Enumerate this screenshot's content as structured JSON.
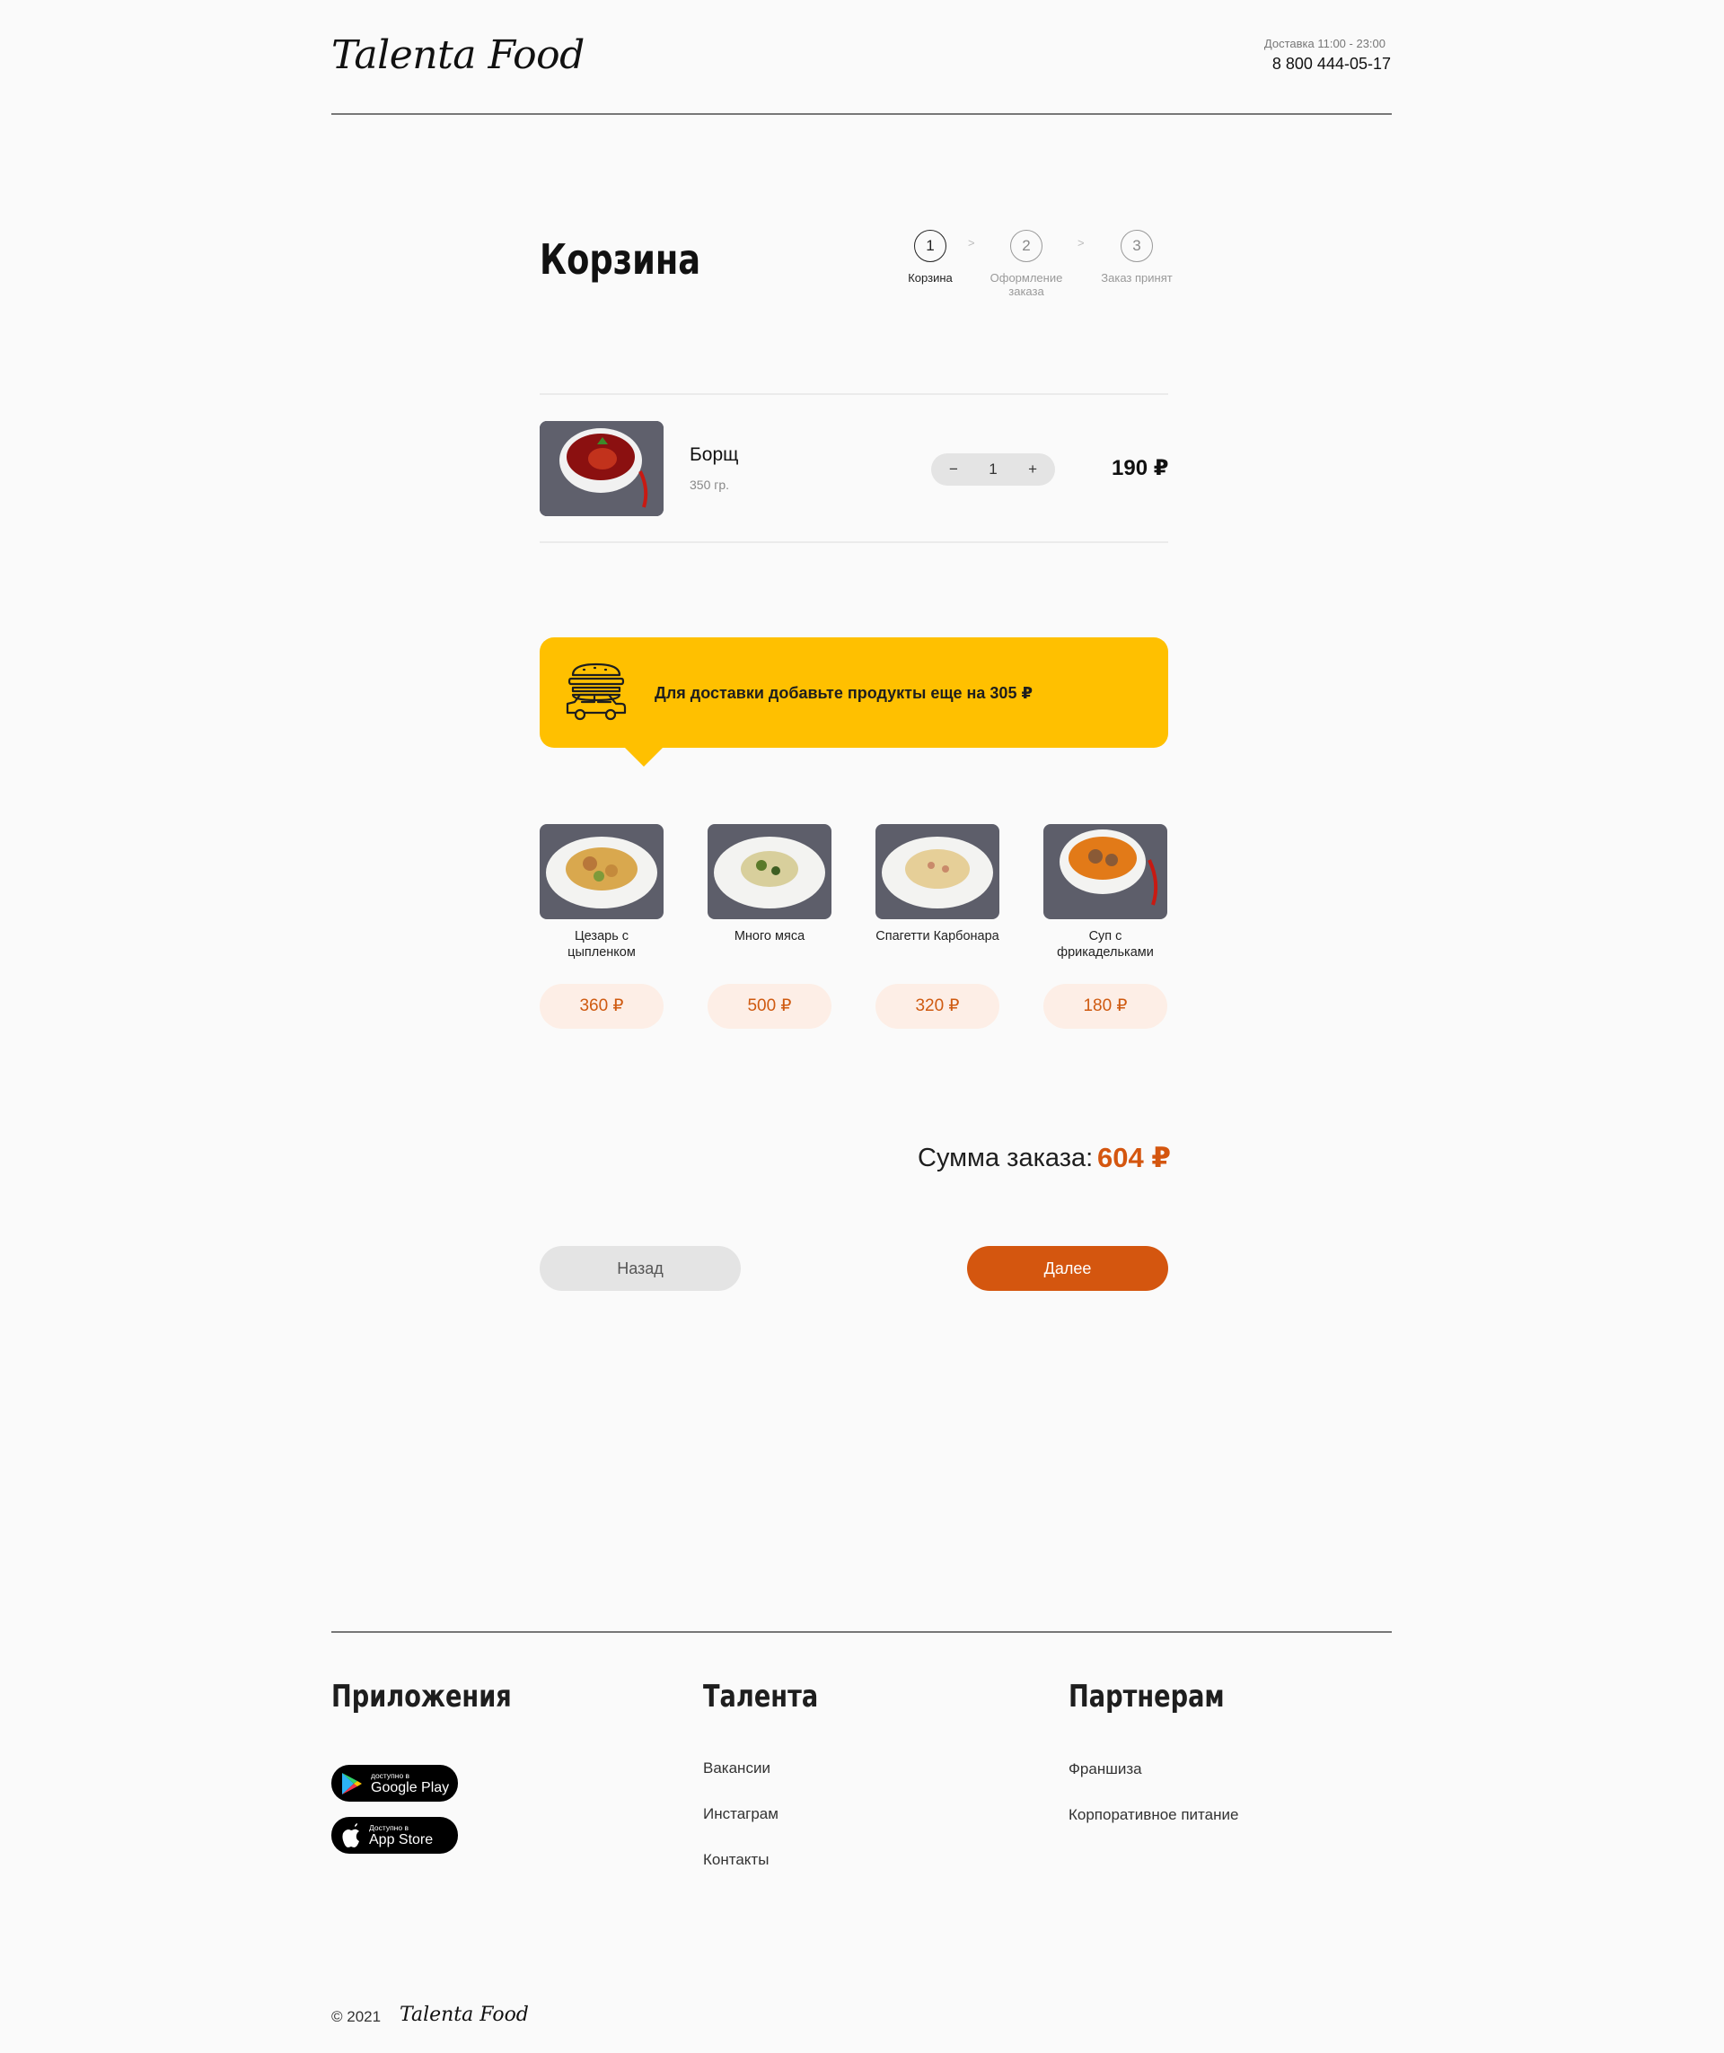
{
  "header": {
    "logo": "Talenta Food",
    "delivery_hours": "Доставка 11:00 - 23:00",
    "phone": "8 800 444-05-17"
  },
  "page": {
    "title": "Корзина"
  },
  "steps": [
    {
      "number": "1",
      "label": "Корзина",
      "active": true
    },
    {
      "number": "2",
      "label": "Оформление заказа",
      "active": false
    },
    {
      "number": "3",
      "label": "Заказ принят",
      "active": false
    }
  ],
  "step_separator": ">",
  "cart": {
    "items": [
      {
        "name": "Борщ",
        "weight": "350 гр.",
        "quantity": "1",
        "minus": "−",
        "plus": "+",
        "price": "190 ₽"
      }
    ]
  },
  "delivery_banner": {
    "text": "Для доставки добавьте продукты еще на 305 ₽",
    "icon": "burger-car-icon",
    "color": "#ffc000"
  },
  "recommendations": [
    {
      "name": "Цезарь с цыпленком",
      "price": "360 ₽"
    },
    {
      "name": "Много мяса",
      "price": "500 ₽"
    },
    {
      "name": "Спагетти Карбонара",
      "price": "320 ₽"
    },
    {
      "name": "Суп с фрикадельками",
      "price": "180 ₽"
    }
  ],
  "summary": {
    "label": "Сумма заказа:",
    "total": "604 ₽"
  },
  "actions": {
    "back": "Назад",
    "next": "Далее"
  },
  "footer": {
    "apps": {
      "heading": "Приложения",
      "google_play": {
        "small": "доступно в",
        "big": "Google Play"
      },
      "app_store": {
        "small": "Доступно в",
        "big": "App Store"
      }
    },
    "talenta": {
      "heading": "Талента",
      "links": [
        "Вакансии",
        "Инстаграм",
        "Контакты"
      ]
    },
    "partners": {
      "heading": "Партнерам",
      "links": [
        "Франшиза",
        "Корпоративное питание"
      ]
    },
    "copyright": "© 2021",
    "logo": "Talenta Food"
  },
  "colors": {
    "accent": "#d4560f",
    "banner": "#ffc000",
    "price_pill_bg": "#fdeee6",
    "background": "#fafafa"
  }
}
